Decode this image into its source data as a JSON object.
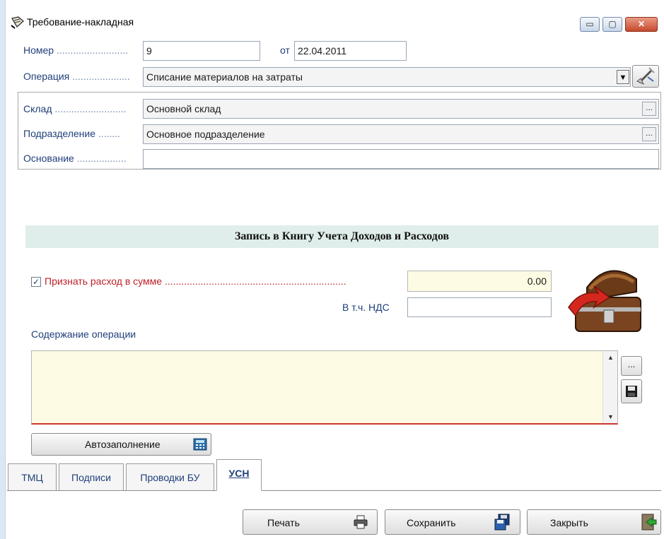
{
  "window": {
    "title": "Требование-накладная",
    "controls": {
      "minimize": "▭",
      "maximize": "▢",
      "close": "✕"
    }
  },
  "form": {
    "number_label": "Номер",
    "number_value": "9",
    "date_label": "от",
    "date_value": "22.04.2011",
    "operation_label": "Операция",
    "operation_value": "Списание материалов на затраты",
    "warehouse_label": "Склад",
    "warehouse_value": "Основной склад",
    "department_label": "Подразделение",
    "department_value": "Основное подразделение",
    "basis_label": "Основание",
    "basis_value": "",
    "ellipsis": "..."
  },
  "kudir": {
    "section_title": "Запись в Книгу Учета Доходов и Расходов",
    "recognize_checked": true,
    "recognize_label": "Признать расход в сумме",
    "recognize_amount": "0.00",
    "vat_label": "В т.ч. НДС",
    "vat_value": "",
    "content_label": "Содержание операции",
    "content_value": "",
    "autofill_label": "Автозаполнение"
  },
  "tabs": [
    {
      "label": "ТМЦ",
      "active": false
    },
    {
      "label": "Подписи",
      "active": false
    },
    {
      "label": "Проводки БУ",
      "active": false
    },
    {
      "label": "УСН",
      "active": true
    }
  ],
  "footer": {
    "print_label": "Печать",
    "save_label": "Сохранить",
    "close_label": "Закрыть"
  },
  "colors": {
    "label_blue": "#1f3f7a",
    "required_red": "#c0202a",
    "section_bg": "#dfeeea",
    "memo_bg": "#fdfbe3"
  },
  "icons": {
    "title": "document-edit-icon",
    "operation_tool": "wand-icon",
    "chest": "treasure-chest-icon",
    "save_memo": "floppy-disk-icon",
    "autofill": "calculator-icon",
    "print": "printer-icon",
    "save": "save-disks-icon",
    "close": "exit-door-icon"
  }
}
